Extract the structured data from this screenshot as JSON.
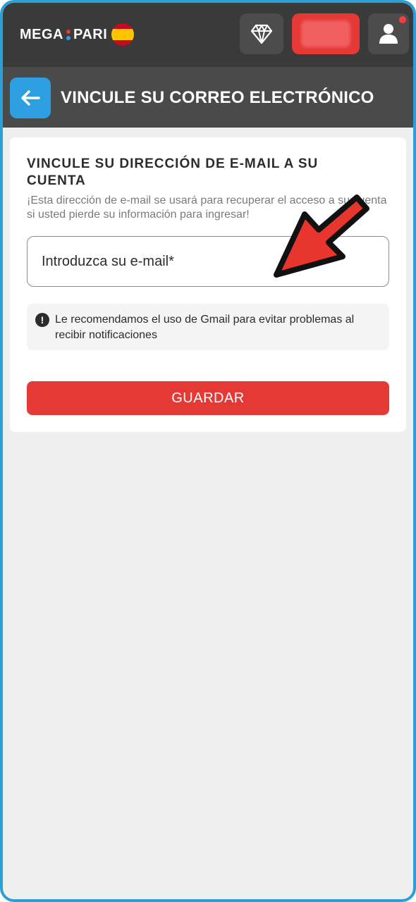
{
  "header": {
    "logo_left": "MEGA",
    "logo_right": "PARI",
    "logo_dot_colors": [
      "#e53935",
      "#2d9ee0"
    ],
    "flag_colors": [
      "#c60b1e",
      "#ffc400",
      "#c60b1e"
    ],
    "diamond_icon": "diamond-icon",
    "user_icon": "user-icon",
    "notification_color": "#ff3b3b"
  },
  "subheader": {
    "back_icon": "arrow-left-icon",
    "title": "VINCULE SU CORREO ELECTRÓNICO"
  },
  "card": {
    "heading": "VINCULE SU DIRECCIÓN DE E-MAIL A SU CUENTA",
    "description": "¡Esta dirección de e-mail se usará para recuperar el acceso a su cuenta si usted pierde su información para ingresar!",
    "email_placeholder": "Introduzca su e-mail*",
    "email_value": "",
    "notice_icon": "exclamation-icon",
    "notice_text": "Le recomendamos el uso de Gmail para evitar problemas al recibir notificaciones",
    "save_label": "GUARDAR"
  },
  "colors": {
    "accent_red": "#e53935",
    "accent_blue": "#2d9ee0",
    "header_dark": "#3a3a3a",
    "frame_border": "#2a9fd8"
  }
}
